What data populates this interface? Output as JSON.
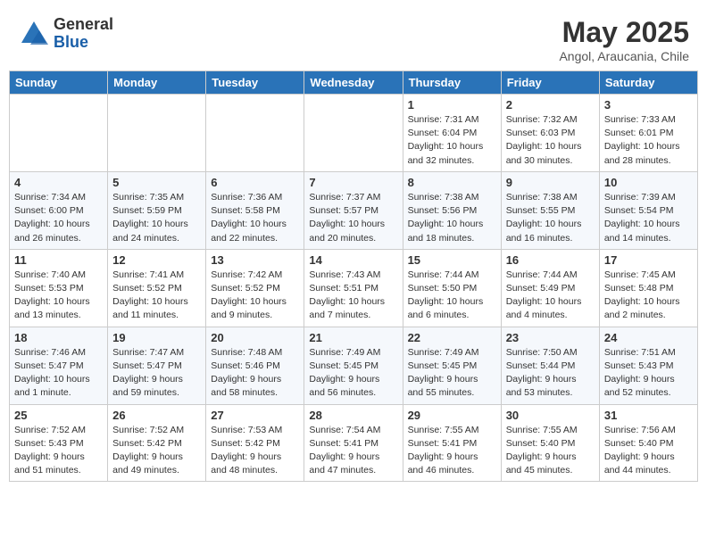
{
  "logo": {
    "general": "General",
    "blue": "Blue"
  },
  "title": "May 2025",
  "location": "Angol, Araucania, Chile",
  "days_header": [
    "Sunday",
    "Monday",
    "Tuesday",
    "Wednesday",
    "Thursday",
    "Friday",
    "Saturday"
  ],
  "weeks": [
    [
      {
        "num": "",
        "info": ""
      },
      {
        "num": "",
        "info": ""
      },
      {
        "num": "",
        "info": ""
      },
      {
        "num": "",
        "info": ""
      },
      {
        "num": "1",
        "info": "Sunrise: 7:31 AM\nSunset: 6:04 PM\nDaylight: 10 hours\nand 32 minutes."
      },
      {
        "num": "2",
        "info": "Sunrise: 7:32 AM\nSunset: 6:03 PM\nDaylight: 10 hours\nand 30 minutes."
      },
      {
        "num": "3",
        "info": "Sunrise: 7:33 AM\nSunset: 6:01 PM\nDaylight: 10 hours\nand 28 minutes."
      }
    ],
    [
      {
        "num": "4",
        "info": "Sunrise: 7:34 AM\nSunset: 6:00 PM\nDaylight: 10 hours\nand 26 minutes."
      },
      {
        "num": "5",
        "info": "Sunrise: 7:35 AM\nSunset: 5:59 PM\nDaylight: 10 hours\nand 24 minutes."
      },
      {
        "num": "6",
        "info": "Sunrise: 7:36 AM\nSunset: 5:58 PM\nDaylight: 10 hours\nand 22 minutes."
      },
      {
        "num": "7",
        "info": "Sunrise: 7:37 AM\nSunset: 5:57 PM\nDaylight: 10 hours\nand 20 minutes."
      },
      {
        "num": "8",
        "info": "Sunrise: 7:38 AM\nSunset: 5:56 PM\nDaylight: 10 hours\nand 18 minutes."
      },
      {
        "num": "9",
        "info": "Sunrise: 7:38 AM\nSunset: 5:55 PM\nDaylight: 10 hours\nand 16 minutes."
      },
      {
        "num": "10",
        "info": "Sunrise: 7:39 AM\nSunset: 5:54 PM\nDaylight: 10 hours\nand 14 minutes."
      }
    ],
    [
      {
        "num": "11",
        "info": "Sunrise: 7:40 AM\nSunset: 5:53 PM\nDaylight: 10 hours\nand 13 minutes."
      },
      {
        "num": "12",
        "info": "Sunrise: 7:41 AM\nSunset: 5:52 PM\nDaylight: 10 hours\nand 11 minutes."
      },
      {
        "num": "13",
        "info": "Sunrise: 7:42 AM\nSunset: 5:52 PM\nDaylight: 10 hours\nand 9 minutes."
      },
      {
        "num": "14",
        "info": "Sunrise: 7:43 AM\nSunset: 5:51 PM\nDaylight: 10 hours\nand 7 minutes."
      },
      {
        "num": "15",
        "info": "Sunrise: 7:44 AM\nSunset: 5:50 PM\nDaylight: 10 hours\nand 6 minutes."
      },
      {
        "num": "16",
        "info": "Sunrise: 7:44 AM\nSunset: 5:49 PM\nDaylight: 10 hours\nand 4 minutes."
      },
      {
        "num": "17",
        "info": "Sunrise: 7:45 AM\nSunset: 5:48 PM\nDaylight: 10 hours\nand 2 minutes."
      }
    ],
    [
      {
        "num": "18",
        "info": "Sunrise: 7:46 AM\nSunset: 5:47 PM\nDaylight: 10 hours\nand 1 minute."
      },
      {
        "num": "19",
        "info": "Sunrise: 7:47 AM\nSunset: 5:47 PM\nDaylight: 9 hours\nand 59 minutes."
      },
      {
        "num": "20",
        "info": "Sunrise: 7:48 AM\nSunset: 5:46 PM\nDaylight: 9 hours\nand 58 minutes."
      },
      {
        "num": "21",
        "info": "Sunrise: 7:49 AM\nSunset: 5:45 PM\nDaylight: 9 hours\nand 56 minutes."
      },
      {
        "num": "22",
        "info": "Sunrise: 7:49 AM\nSunset: 5:45 PM\nDaylight: 9 hours\nand 55 minutes."
      },
      {
        "num": "23",
        "info": "Sunrise: 7:50 AM\nSunset: 5:44 PM\nDaylight: 9 hours\nand 53 minutes."
      },
      {
        "num": "24",
        "info": "Sunrise: 7:51 AM\nSunset: 5:43 PM\nDaylight: 9 hours\nand 52 minutes."
      }
    ],
    [
      {
        "num": "25",
        "info": "Sunrise: 7:52 AM\nSunset: 5:43 PM\nDaylight: 9 hours\nand 51 minutes."
      },
      {
        "num": "26",
        "info": "Sunrise: 7:52 AM\nSunset: 5:42 PM\nDaylight: 9 hours\nand 49 minutes."
      },
      {
        "num": "27",
        "info": "Sunrise: 7:53 AM\nSunset: 5:42 PM\nDaylight: 9 hours\nand 48 minutes."
      },
      {
        "num": "28",
        "info": "Sunrise: 7:54 AM\nSunset: 5:41 PM\nDaylight: 9 hours\nand 47 minutes."
      },
      {
        "num": "29",
        "info": "Sunrise: 7:55 AM\nSunset: 5:41 PM\nDaylight: 9 hours\nand 46 minutes."
      },
      {
        "num": "30",
        "info": "Sunrise: 7:55 AM\nSunset: 5:40 PM\nDaylight: 9 hours\nand 45 minutes."
      },
      {
        "num": "31",
        "info": "Sunrise: 7:56 AM\nSunset: 5:40 PM\nDaylight: 9 hours\nand 44 minutes."
      }
    ]
  ]
}
